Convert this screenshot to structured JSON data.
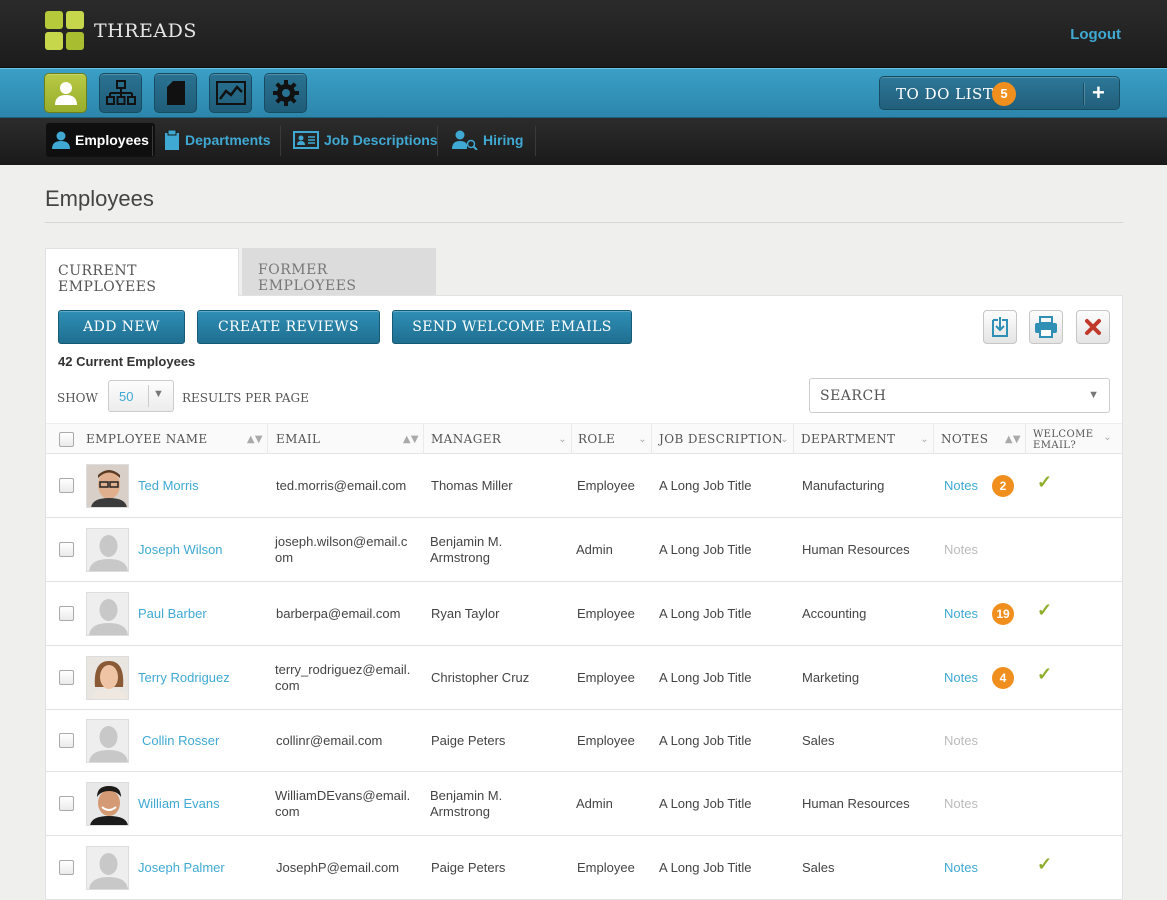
{
  "app": {
    "brand": "THREADS",
    "logout": "Logout"
  },
  "modules": [
    {
      "icon": "employee-icon",
      "active": true
    },
    {
      "icon": "org-chart-icon",
      "active": false
    },
    {
      "icon": "document-icon",
      "active": false
    },
    {
      "icon": "chart-icon",
      "active": false
    },
    {
      "icon": "gear-icon",
      "active": false
    }
  ],
  "todo": {
    "label": "TO DO LIST",
    "count": "5"
  },
  "subnav": {
    "employees": "Employees",
    "departments": "Departments",
    "job_descriptions": "Job Descriptions",
    "hiring": "Hiring"
  },
  "page": {
    "title": "Employees"
  },
  "tabs": {
    "current": "CURRENT EMPLOYEES",
    "former": "FORMER EMPLOYEES"
  },
  "actions": {
    "add_new": "ADD NEW",
    "create_reviews": "CREATE REVIEWS",
    "send_welcome": "SEND WELCOME EMAILS"
  },
  "count_label": "42 Current Employees",
  "paging": {
    "show": "SHOW",
    "value": "50",
    "per_page": "RESULTS PER PAGE"
  },
  "search": {
    "placeholder": "SEARCH"
  },
  "columns": {
    "name": "EMPLOYEE NAME",
    "email": "EMAIL",
    "manager": "MANAGER",
    "role": "ROLE",
    "job": "JOB DESCRIPTION",
    "department": "DEPARTMENT",
    "notes": "NOTES",
    "welcome_1": "WELCOME",
    "welcome_2": "EMAIL?"
  },
  "rows": [
    {
      "name": "Ted Morris",
      "email1": "ted.morris@email.com",
      "email2": "",
      "manager1": "Thomas Miller",
      "manager2": "",
      "role": "Employee",
      "job": "A Long Job Title",
      "department": "Manufacturing",
      "notes": "Notes",
      "notes_active": true,
      "note_count": "2",
      "welcome": true,
      "avatar": "photo-man-glasses"
    },
    {
      "name": "Joseph Wilson",
      "email1": "joseph.wilson@email.c",
      "email2": "om",
      "manager1": "Benjamin M.",
      "manager2": "Armstrong",
      "role": "Admin",
      "job": "A Long Job Title",
      "department": "Human Resources",
      "notes": "Notes",
      "notes_active": false,
      "note_count": "",
      "welcome": false,
      "avatar": "placeholder"
    },
    {
      "name": "Paul Barber",
      "email1": "barberpa@email.com",
      "email2": "",
      "manager1": "Ryan Taylor",
      "manager2": "",
      "role": "Employee",
      "job": "A Long Job Title",
      "department": "Accounting",
      "notes": "Notes",
      "notes_active": true,
      "note_count": "19",
      "welcome": true,
      "avatar": "placeholder"
    },
    {
      "name": "Terry Rodriguez",
      "email1": "terry_rodriguez@email.",
      "email2": "com",
      "manager1": "Christopher Cruz",
      "manager2": "",
      "role": "Employee",
      "job": "A Long Job Title",
      "department": "Marketing",
      "notes": "Notes",
      "notes_active": true,
      "note_count": "4",
      "welcome": true,
      "avatar": "photo-woman"
    },
    {
      "name": "Collin Rosser",
      "email1": "collinr@email.com",
      "email2": "",
      "manager1": "Paige Peters",
      "manager2": "",
      "role": "Employee",
      "job": "A Long Job Title",
      "department": "Sales",
      "notes": "Notes",
      "notes_active": false,
      "note_count": "",
      "welcome": false,
      "avatar": "placeholder"
    },
    {
      "name": "William Evans",
      "email1": "WilliamDEvans@email.",
      "email2": "com",
      "manager1": "Benjamin M.",
      "manager2": "Armstrong",
      "role": "Admin",
      "job": "A Long Job Title",
      "department": "Human Resources",
      "notes": "Notes",
      "notes_active": false,
      "note_count": "",
      "welcome": false,
      "avatar": "photo-man-smiling"
    },
    {
      "name": "Joseph Palmer",
      "email1": "JosephP@email.com",
      "email2": "",
      "manager1": "Paige Peters",
      "manager2": "",
      "role": "Employee",
      "job": "A Long Job Title",
      "department": "Sales",
      "notes": "Notes",
      "notes_active": true,
      "note_count": "",
      "welcome": true,
      "avatar": "placeholder"
    }
  ],
  "colors": {
    "accent": "#3fa9d3",
    "brand_green": "#b5c93b",
    "badge_orange": "#f08f1d",
    "check_green": "#8fae2c"
  }
}
